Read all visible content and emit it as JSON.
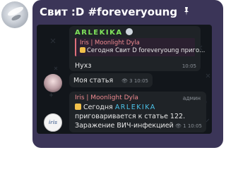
{
  "header": {
    "title": "Свит :D #foreveryoung"
  },
  "messages": [
    {
      "sender": "ARLEKIKA",
      "reply": {
        "name": "Iris | Moonlight Dyla",
        "text": "Сегодня Свит D foreveryoung приго..."
      },
      "text": "Нухз",
      "time": "10:05"
    },
    {
      "text": "Моя статья",
      "views": "3",
      "time": "10:05"
    },
    {
      "sender": "Iris | Moonlight Dyla",
      "role": "админ",
      "line1_prefix": "Сегодня",
      "line1_highlight": "ARLEKIKA",
      "line2": "приговаривается к статье 122.",
      "line3": "Заражение ВИЧ-инфекцией",
      "views": "1",
      "time": "10:05",
      "avatar_text": "iris"
    }
  ],
  "colors": {
    "card_bg": "#3b3558",
    "chat_bg": "#12161b",
    "bubble_bg": "#1f2327",
    "arlekika_name": "#7fe35b",
    "iris_name": "#ef8a90",
    "highlight": "#4cc3ea"
  }
}
